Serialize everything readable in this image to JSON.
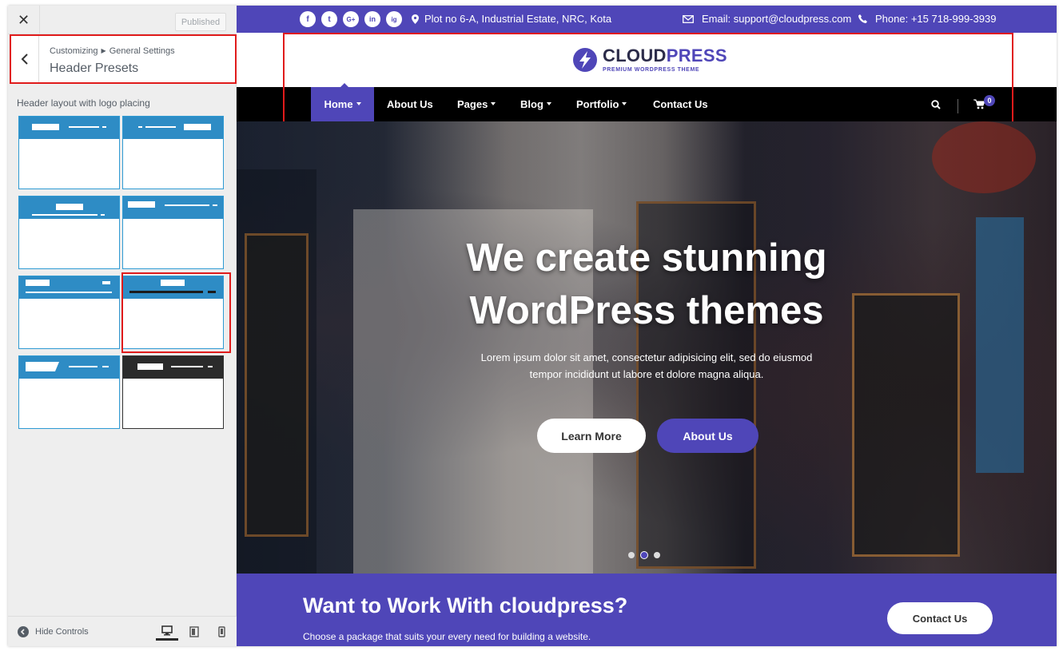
{
  "sidebar": {
    "close_icon": "close-icon",
    "published_label": "Published",
    "breadcrumb": [
      "Customizing",
      "General Settings"
    ],
    "section_title": "Header Presets",
    "presets_label": "Header layout with logo placing",
    "hide_controls_label": "Hide Controls",
    "devices": [
      "desktop-icon",
      "tablet-icon",
      "mobile-icon"
    ],
    "selected_preset": 6
  },
  "preview": {
    "topbar": {
      "social": [
        "f",
        "t",
        "G+",
        "in",
        "ig"
      ],
      "address": "Plot no 6-A, Industrial Estate, NRC, Kota",
      "email": "Email: support@cloudpress.com",
      "phone": "Phone: +15 718-999-3939"
    },
    "logo": {
      "name_part1": "CLOUD",
      "name_part2": "PRESS",
      "tagline": "PREMIUM WORDPRESS THEME"
    },
    "nav": {
      "items": [
        "Home",
        "About Us",
        "Pages",
        "Blog",
        "Portfolio",
        "Contact Us"
      ],
      "active": "Home",
      "cart_count": "0"
    },
    "hero": {
      "title_line1": "We create stunning",
      "title_line2": "WordPress themes",
      "subtitle_line1": "Lorem ipsum dolor sit amet, consectetur adipisicing elit, sed do eiusmod",
      "subtitle_line2": "tempor incididunt ut labore et dolore magna aliqua.",
      "btn_primary": "Learn More",
      "btn_secondary": "About Us",
      "slides": 3,
      "active_slide": 2
    },
    "cta": {
      "title": "Want to Work With cloudpress?",
      "subtitle": "Choose a package that suits your every need for building a website.",
      "button": "Contact Us"
    }
  },
  "colors": {
    "brand": "#4f46b8",
    "preset_blue": "#2e8cc5",
    "highlight_red": "#e01b1b",
    "nav_bg": "#000000"
  }
}
